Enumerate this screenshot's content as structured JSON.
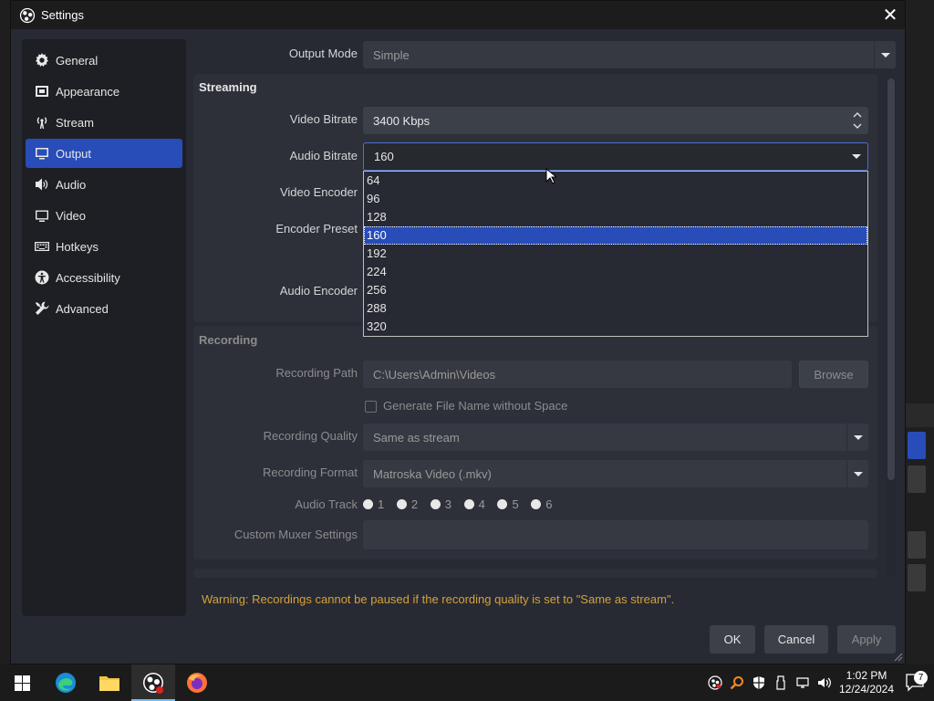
{
  "window": {
    "title": "Settings"
  },
  "sidebar": {
    "items": [
      {
        "label": "General",
        "icon": "gear-icon"
      },
      {
        "label": "Appearance",
        "icon": "appearance-icon"
      },
      {
        "label": "Stream",
        "icon": "antenna-icon"
      },
      {
        "label": "Output",
        "icon": "monitor-icon",
        "active": true
      },
      {
        "label": "Audio",
        "icon": "speaker-icon"
      },
      {
        "label": "Video",
        "icon": "screen-icon"
      },
      {
        "label": "Hotkeys",
        "icon": "keyboard-icon"
      },
      {
        "label": "Accessibility",
        "icon": "accessibility-icon"
      },
      {
        "label": "Advanced",
        "icon": "tools-icon"
      }
    ]
  },
  "output_mode": {
    "label": "Output Mode",
    "value": "Simple"
  },
  "streaming": {
    "title": "Streaming",
    "video_bitrate": {
      "label": "Video Bitrate",
      "value": "3400 Kbps"
    },
    "audio_bitrate": {
      "label": "Audio Bitrate",
      "value": "160",
      "options": [
        "64",
        "96",
        "128",
        "160",
        "192",
        "224",
        "256",
        "288",
        "320"
      ],
      "selected": "160"
    },
    "video_encoder": {
      "label": "Video Encoder"
    },
    "encoder_preset": {
      "label": "Encoder Preset"
    },
    "audio_encoder": {
      "label": "Audio Encoder"
    }
  },
  "recording": {
    "title": "Recording",
    "path": {
      "label": "Recording Path",
      "value": "C:\\Users\\Admin\\Videos",
      "browse": "Browse"
    },
    "no_space": {
      "label": "Generate File Name without Space"
    },
    "quality": {
      "label": "Recording Quality",
      "value": "Same as stream"
    },
    "format": {
      "label": "Recording Format",
      "value": "Matroska Video (.mkv)"
    },
    "audio_track": {
      "label": "Audio Track",
      "tracks": [
        "1",
        "2",
        "3",
        "4",
        "5",
        "6"
      ]
    },
    "muxer": {
      "label": "Custom Muxer Settings",
      "value": ""
    }
  },
  "warning": "Warning: Recordings cannot be paused if the recording quality is set to \"Same as stream\".",
  "buttons": {
    "ok": "OK",
    "cancel": "Cancel",
    "apply": "Apply"
  },
  "taskbar": {
    "time": "1:02 PM",
    "date": "12/24/2024",
    "notification_count": "7"
  },
  "colors": {
    "accent": "#284cb8",
    "warning": "#d4a13a"
  }
}
